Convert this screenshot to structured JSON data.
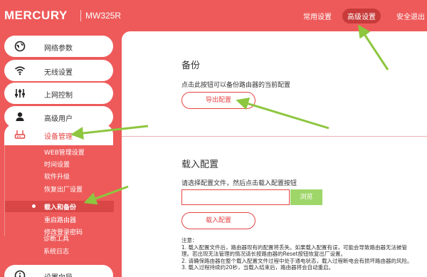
{
  "header": {
    "brand": "MERCURY",
    "model": "MW325R",
    "nav": {
      "basic": "常用设置",
      "advanced": "高级设置",
      "logout": "安全退出"
    }
  },
  "sidebar": {
    "items": [
      {
        "label": "网络参数",
        "icon": "globe-icon"
      },
      {
        "label": "无线设置",
        "icon": "wifi-icon"
      },
      {
        "label": "上网控制",
        "icon": "sliders-icon"
      },
      {
        "label": "高级用户",
        "icon": "user-icon"
      },
      {
        "label": "设备管理",
        "icon": "router-icon"
      },
      {
        "label": "设置向导",
        "icon": "info-icon"
      }
    ],
    "submenu": [
      "WEB管理设置",
      "时间设置",
      "软件升级",
      "恢复出厂设置",
      "载入和备份",
      "重启路由器",
      "修改登录密码",
      "诊断工具",
      "系统日志"
    ],
    "selected_sub": "载入和备份"
  },
  "backup": {
    "title": "备份",
    "description": "点击此按钮可以备份路由器的当前配置",
    "button": "导出配置"
  },
  "load": {
    "title": "载入配置",
    "description": "请选择配置文件，然后点击载入配置按钮",
    "file_value": "",
    "browse_button": "浏览",
    "button": "载入配置"
  },
  "notes": {
    "heading": "注意：",
    "lines": [
      "1. 载入配置文件后，路由器现有的配置将丢失。如果载入配置有误，可能会导致路由器无法被管",
      "   理。若出现无法管理的情况请长按路由器的Reset按钮恢复出厂设置。",
      "2. 请确保路由器在整个载入配置文件过程中处于通电状态，载入过程断电会有损坏路由器的风险。",
      "3. 载入过程持续约20秒，当载入结束后，路由器将会自动重启。"
    ]
  },
  "colors": {
    "brand_red": "#ee5a5a",
    "accent_red": "#e64545",
    "browse_green": "#9fd66a",
    "annotation_arrow": "#8dc63f"
  }
}
